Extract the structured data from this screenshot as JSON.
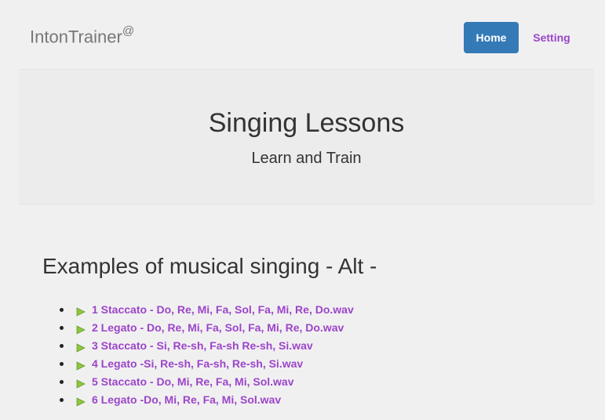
{
  "navbar": {
    "brand": "IntonTrainer",
    "brand_sup": "@",
    "home_label": "Home",
    "setting_label": "Setting"
  },
  "jumbotron": {
    "title": "Singing Lessons",
    "subtitle": "Learn and Train"
  },
  "section": {
    "title": "Examples of musical singing - Alt -"
  },
  "lessons": [
    "1 Staccato - Do, Re, Mi, Fa, Sol, Fa, Mi, Re, Do.wav",
    "2 Legato - Do, Re, Mi, Fa, Sol, Fa, Mi, Re, Do.wav",
    "3 Staccato - Si, Re-sh, Fa-sh Re-sh, Si.wav",
    "4 Legato -Si, Re-sh, Fa-sh, Re-sh, Si.wav",
    "5 Staccato - Do, Mi, Re, Fa, Mi, Sol.wav",
    "6 Legato -Do, Mi, Re, Fa, Mi, Sol.wav"
  ],
  "colors": {
    "primary": "#337ab7",
    "link": "#9b45c9",
    "play_icon": "#8dc63f"
  },
  "icons": {
    "play": "play-icon"
  }
}
